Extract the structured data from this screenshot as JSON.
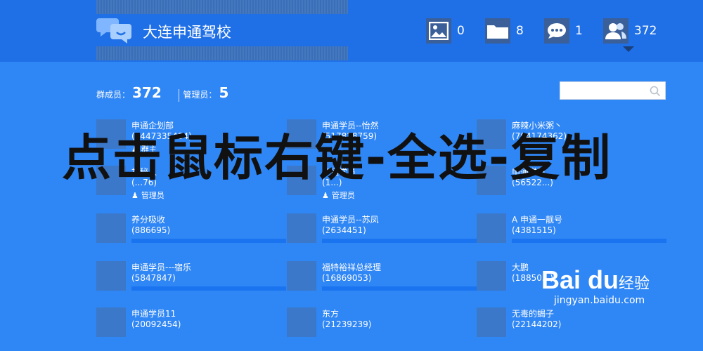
{
  "header": {
    "group_name": "大连申通驾校",
    "stats": [
      {
        "icon": "image-icon",
        "value": "0"
      },
      {
        "icon": "folder-icon",
        "value": "8"
      },
      {
        "icon": "chat-icon",
        "value": "1"
      },
      {
        "icon": "users-icon",
        "value": "372"
      }
    ]
  },
  "summary": {
    "members_label": "群成员：",
    "members_count": "372",
    "admins_label": "管理员：",
    "admins_count": "5"
  },
  "search": {
    "placeholder": ""
  },
  "members": [
    {
      "name": "申通企划部",
      "qq": "(1447335404)",
      "role": "群主"
    },
    {
      "name": "申通学员--怡然",
      "qq": "(517828759)",
      "role": ""
    },
    {
      "name": "麻辣小米粥丶",
      "qq": "(704174362)",
      "role": ""
    },
    {
      "name": "神秘人",
      "qq": "(...76)",
      "role": "管理员"
    },
    {
      "name": "申通学员",
      "qq": "(1...)",
      "role": "管理员"
    },
    {
      "name": "申通学员",
      "qq": "(56522...)",
      "role": ""
    },
    {
      "name": "养分吸收",
      "qq": "(886695)",
      "role": ""
    },
    {
      "name": "申通学员--苏凤",
      "qq": "(2634451)",
      "role": ""
    },
    {
      "name": "A 申通一靓号",
      "qq": "(4381515)",
      "role": ""
    },
    {
      "name": "申通学员---宿乐",
      "qq": "(5847847)",
      "role": ""
    },
    {
      "name": "福特裕祥总经理",
      "qq": "(16869053)",
      "role": ""
    },
    {
      "name": "大鹏",
      "qq": "(18850...)",
      "role": ""
    },
    {
      "name": "申通学员11",
      "qq": "(20092454)",
      "role": ""
    },
    {
      "name": "东方",
      "qq": "(21239239)",
      "role": ""
    },
    {
      "name": "无毒的蝎子",
      "qq": "(22144202)",
      "role": ""
    }
  ],
  "overlay_text": "点击鼠标右键-全选-复制",
  "watermark": {
    "logo": "Bai du",
    "text": "经验",
    "url": "jingyan.baidu.com"
  },
  "colors": {
    "background": "#2f86f5",
    "header": "#1f6fe6"
  }
}
